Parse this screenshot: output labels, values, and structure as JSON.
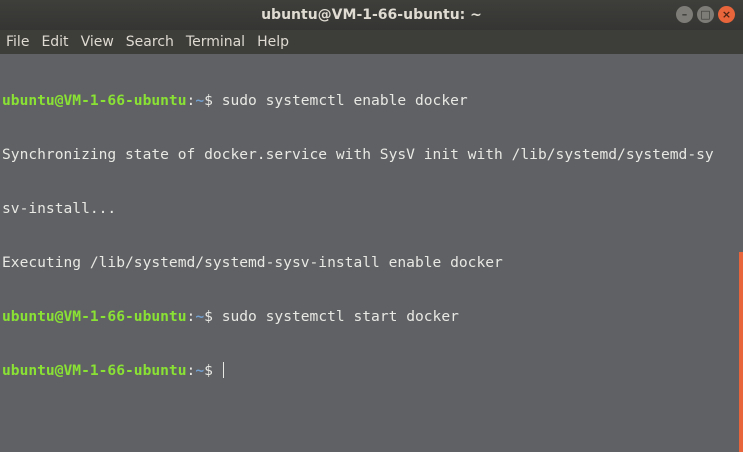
{
  "window": {
    "title": "ubuntu@VM-1-66-ubuntu: ~",
    "controls": {
      "minimize": "–",
      "maximize": "□",
      "close": "×"
    }
  },
  "menu": {
    "items": [
      "File",
      "Edit",
      "View",
      "Search",
      "Terminal",
      "Help"
    ]
  },
  "terminal": {
    "prompt_user": "ubuntu@VM-1-66-ubuntu",
    "prompt_colon": ":",
    "prompt_path": "~",
    "prompt_symbol": "$ ",
    "lines": [
      {
        "type": "command",
        "text": "sudo systemctl enable docker"
      },
      {
        "type": "output",
        "text": "Synchronizing state of docker.service with SysV init with /lib/systemd/systemd-sy"
      },
      {
        "type": "output",
        "text": "sv-install..."
      },
      {
        "type": "output",
        "text": "Executing /lib/systemd/systemd-sysv-install enable docker"
      },
      {
        "type": "command",
        "text": "sudo systemctl start docker"
      },
      {
        "type": "command",
        "text": ""
      }
    ]
  },
  "colors": {
    "titlebar": "#3e3e3b",
    "terminal_bg": "#5f6164",
    "prompt_user": "#8ae234",
    "prompt_path": "#729fcf",
    "close_button": "#e8643a"
  }
}
